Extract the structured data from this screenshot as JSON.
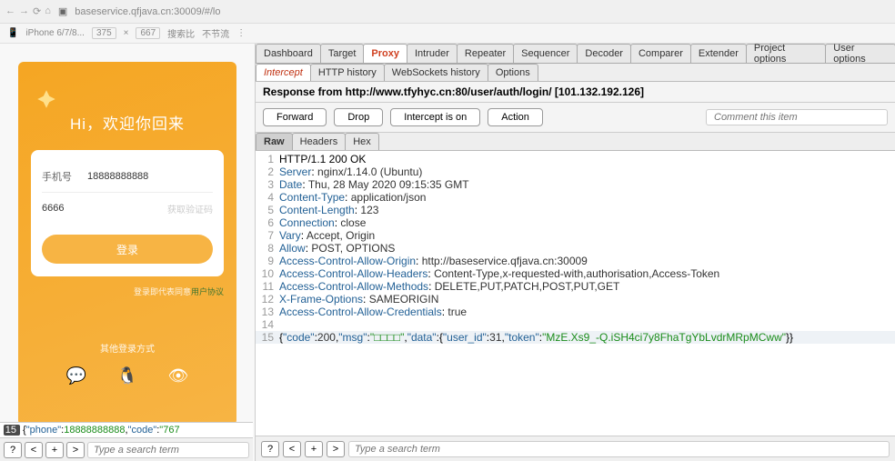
{
  "browser": {
    "url": "baseservice.qfjava.cn:30009/#/lo",
    "device": "iPhone 6/7/8...",
    "width": "375",
    "height": "667",
    "zoom_hint": "搜索比",
    "throttle": "不节流"
  },
  "phone": {
    "greeting": "Hi，欢迎你回来",
    "phone_label": "手机号",
    "phone_value": "18888888888",
    "code_value": "6666",
    "code_hint": "获取验证码",
    "login_label": "登录",
    "terms_prefix": "登录即代表同意",
    "terms_link": "用户协议",
    "other_login": "其他登录方式"
  },
  "tabs": [
    "Dashboard",
    "Target",
    "Proxy",
    "Intruder",
    "Repeater",
    "Sequencer",
    "Decoder",
    "Comparer",
    "Extender",
    "Project options",
    "User options"
  ],
  "active_tab": 2,
  "subtabs": [
    "Intercept",
    "HTTP history",
    "WebSockets history",
    "Options"
  ],
  "active_subtab": 0,
  "response_info": "Response from http://www.tfyhyc.cn:80/user/auth/login/  [101.132.192.126]",
  "actions": {
    "forward": "Forward",
    "drop": "Drop",
    "intercept": "Intercept is on",
    "action": "Action"
  },
  "comment_placeholder": "Comment this item",
  "viewtabs": [
    "Raw",
    "Headers",
    "Hex"
  ],
  "active_viewtab": 0,
  "headers": [
    {
      "raw": "HTTP/1.1 200 OK"
    },
    {
      "k": "Server",
      "v": "nginx/1.14.0 (Ubuntu)"
    },
    {
      "k": "Date",
      "v": "Thu, 28 May 2020 09:15:35 GMT"
    },
    {
      "k": "Content-Type",
      "v": "application/json"
    },
    {
      "k": "Content-Length",
      "v": "123"
    },
    {
      "k": "Connection",
      "v": "close"
    },
    {
      "k": "Vary",
      "v": "Accept, Origin"
    },
    {
      "k": "Allow",
      "v": "POST, OPTIONS"
    },
    {
      "k": "Access-Control-Allow-Origin",
      "v": "http://baseservice.qfjava.cn:30009"
    },
    {
      "k": "Access-Control-Allow-Headers",
      "v": "Content-Type,x-requested-with,authorisation,Access-Token"
    },
    {
      "k": "Access-Control-Allow-Methods",
      "v": "DELETE,PUT,PATCH,POST,PUT,GET"
    },
    {
      "k": "X-Frame-Options",
      "v": "SAMEORIGIN"
    },
    {
      "k": "Access-Control-Allow-Credentials",
      "v": "true"
    }
  ],
  "json_body": {
    "code": 200,
    "msg": "□□□□",
    "data": {
      "user_id": 31,
      "token": "MzE.Xs9_-Q.iSH4ci7y8FhaTgYbLvdrMRpMCww"
    }
  },
  "search_placeholder": "Type a search term",
  "left_snippet": {
    "line_no": "15",
    "phone": "18888888888",
    "code_prefix": "767"
  },
  "chart_data": null
}
